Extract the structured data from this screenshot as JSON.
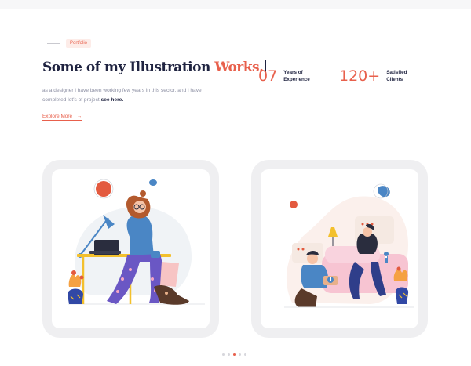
{
  "section": {
    "tag": "Portfolio",
    "headline_main": "Some of my Illustration ",
    "headline_accent": "Works.",
    "description_main": "as a designer i have been working few years in this sector, and i have completed lot's of project ",
    "description_link": "see here.",
    "explore_label": "Explore More",
    "explore_arrow": "→"
  },
  "stats": [
    {
      "number": "07",
      "label": "Years of Experience"
    },
    {
      "number": "120+",
      "label": "Satisfied Clients"
    }
  ],
  "cards": [
    {
      "icon": "woman-at-desk-illustration"
    },
    {
      "icon": "couple-on-sofa-illustration"
    }
  ],
  "carousel": {
    "count": 5,
    "active": 3
  },
  "colors": {
    "accent": "#e8604c",
    "navy": "#1f2340",
    "muted": "#8c8fa3",
    "card_bg": "#efeff1"
  }
}
